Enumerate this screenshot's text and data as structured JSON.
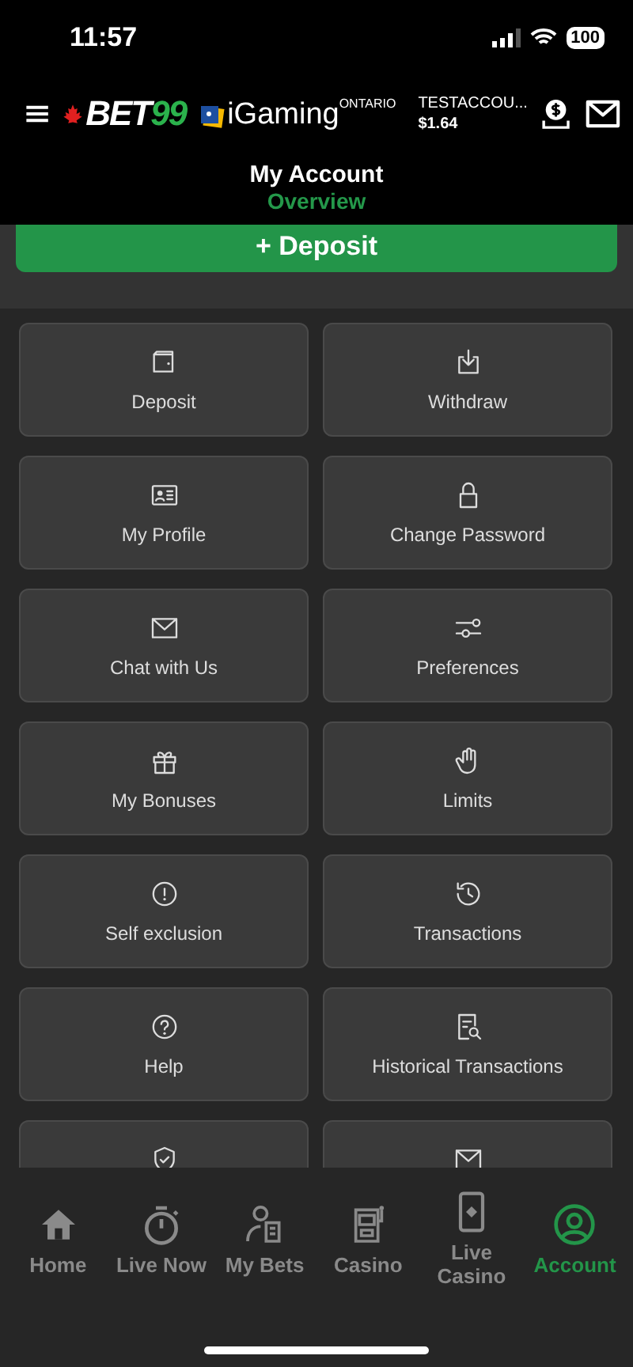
{
  "status_bar": {
    "time": "11:57",
    "battery": "100"
  },
  "header": {
    "brand": "BET",
    "brand_accent": "99",
    "partner": "iGaming",
    "partner_region": "ONTARIO",
    "account_name": "TESTACCOU...",
    "balance": "$1.64"
  },
  "page": {
    "title": "My Account",
    "subtitle": "Overview"
  },
  "deposit_button": "+ Deposit",
  "tiles": [
    {
      "label": "Deposit"
    },
    {
      "label": "Withdraw"
    },
    {
      "label": "My Profile"
    },
    {
      "label": "Change Password"
    },
    {
      "label": "Chat with Us"
    },
    {
      "label": "Preferences"
    },
    {
      "label": "My Bonuses"
    },
    {
      "label": "Limits"
    },
    {
      "label": "Self exclusion"
    },
    {
      "label": "Transactions"
    },
    {
      "label": "Help"
    },
    {
      "label": "Historical Transactions"
    },
    {
      "kind": "partial"
    },
    {
      "kind": "partial"
    }
  ],
  "nav": [
    {
      "label": "Home",
      "selected": false
    },
    {
      "label": "Live Now",
      "selected": false
    },
    {
      "label": "My Bets",
      "selected": false
    },
    {
      "label": "Casino",
      "selected": false
    },
    {
      "label": "Live Casino",
      "selected": false
    },
    {
      "label": "Account",
      "selected": true
    }
  ]
}
